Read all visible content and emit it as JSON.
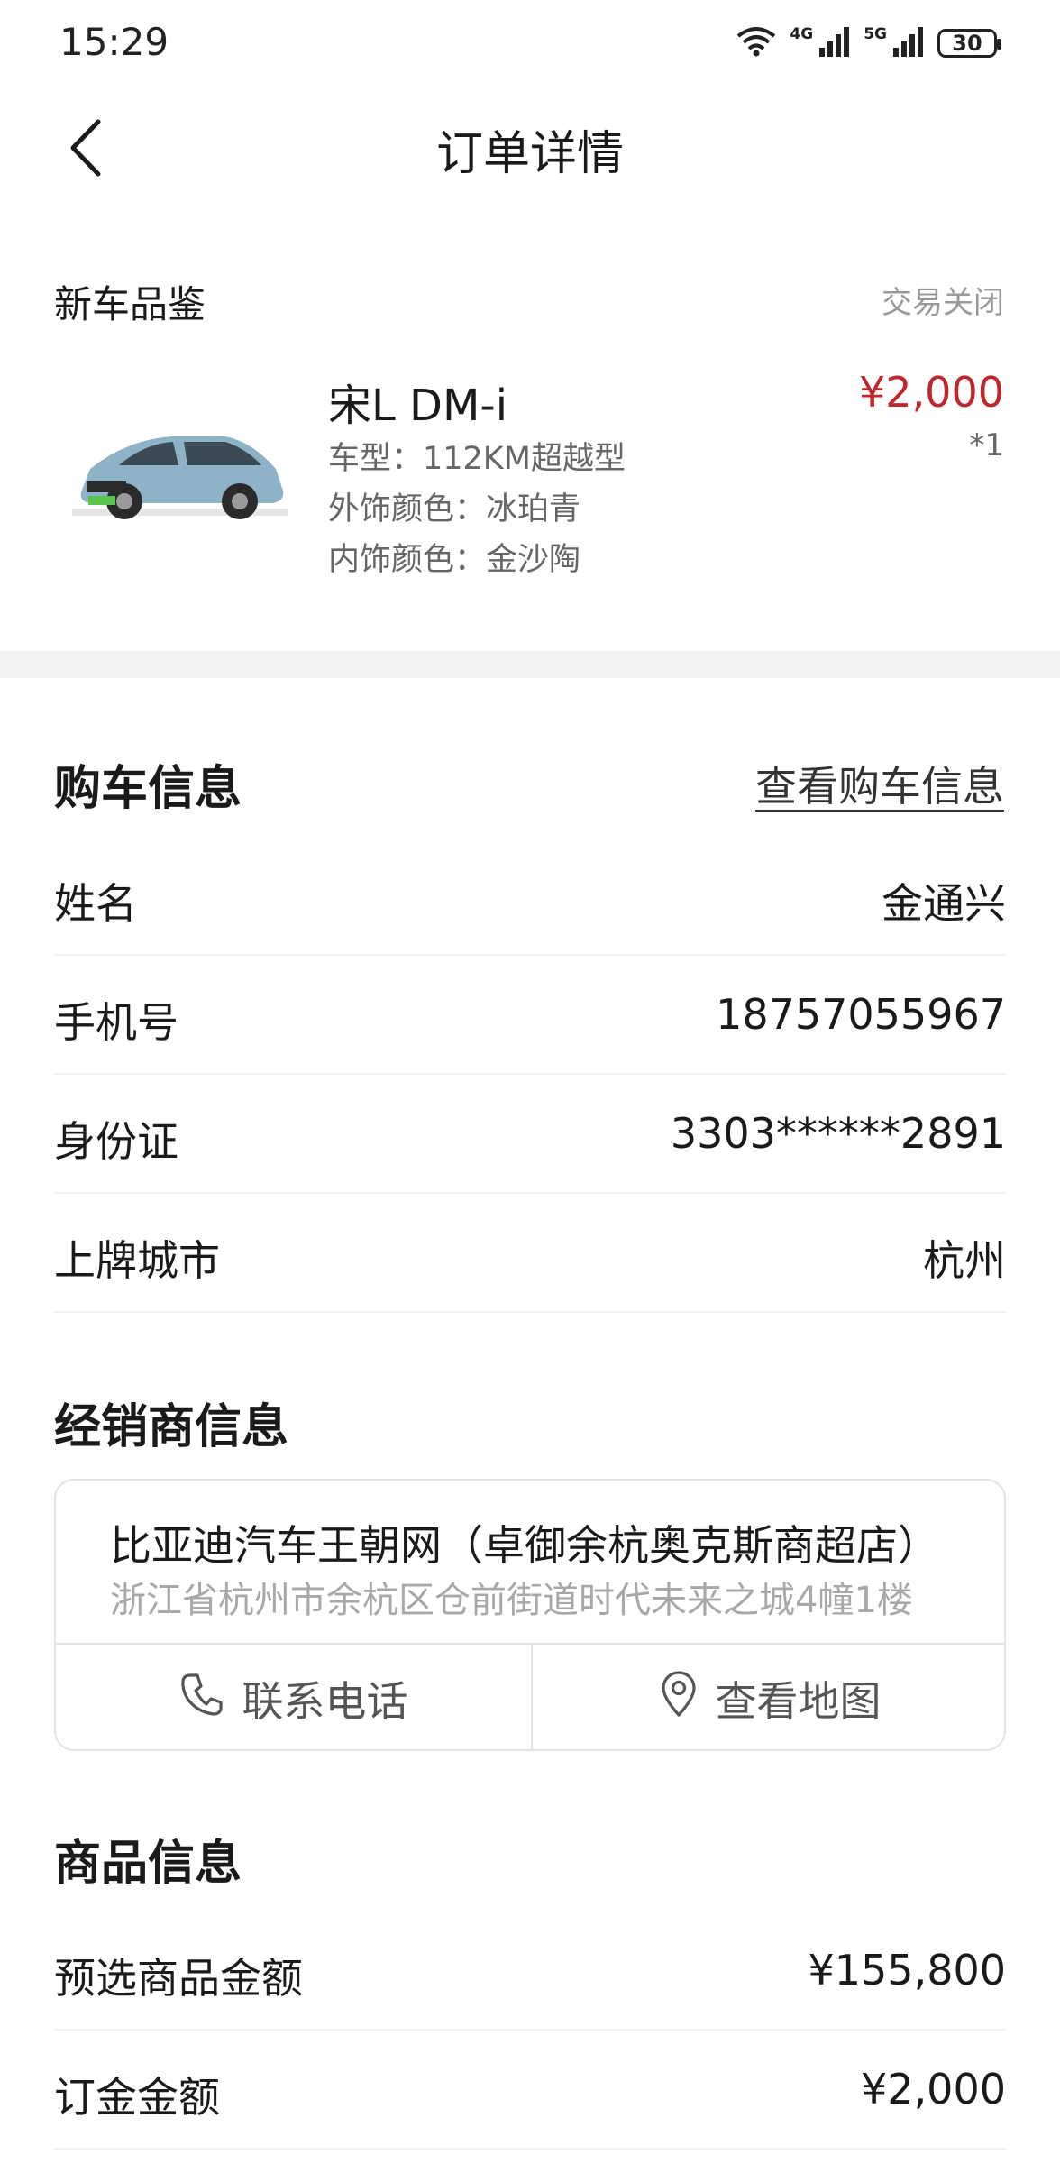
{
  "status_bar": {
    "time": "15:29",
    "network_1": "4G",
    "network_2": "5G",
    "battery": "30"
  },
  "nav": {
    "title": "订单详情",
    "back_icon": "chevron-left-icon"
  },
  "product": {
    "type_label": "新车品鉴",
    "status": "交易关闭",
    "car_name": "宋L DM-i",
    "specs": [
      "车型：112KM超越型",
      "外饰颜色：冰珀青",
      "内饰颜色：金沙陶"
    ],
    "price": "¥2,000",
    "quantity": "*1",
    "accent_color": "#c0272d"
  },
  "purchase_info": {
    "title": "购车信息",
    "view_link": "查看购车信息",
    "rows": [
      {
        "label": "姓名",
        "value": "金通兴"
      },
      {
        "label": "手机号",
        "value": "18757055967"
      },
      {
        "label": "身份证",
        "value": "3303******2891"
      },
      {
        "label": "上牌城市",
        "value": "杭州"
      }
    ]
  },
  "dealer_info": {
    "title": "经销商信息",
    "name": "比亚迪汽车王朝网（卓御余杭奥克斯商超店）",
    "address": "浙江省杭州市余杭区仓前街道时代未来之城4幢1楼",
    "call_label": "联系电话",
    "map_label": "查看地图"
  },
  "goods_info": {
    "title": "商品信息",
    "rows": [
      {
        "label": "预选商品金额",
        "value": "¥155,800"
      },
      {
        "label": "订金金额",
        "value": "¥2,000"
      }
    ]
  }
}
